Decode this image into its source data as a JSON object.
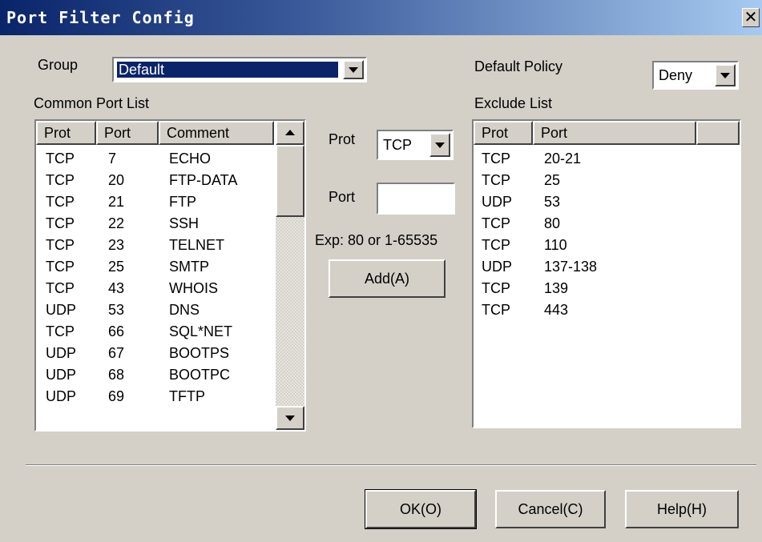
{
  "window": {
    "title": "Port Filter Config",
    "close_glyph": "✕"
  },
  "group": {
    "label": "Group",
    "selected": "Default"
  },
  "default_policy": {
    "label": "Default Policy",
    "selected": "Deny"
  },
  "common_list": {
    "label": "Common Port List",
    "columns": [
      "Prot",
      "Port",
      "Comment"
    ],
    "rows": [
      [
        "TCP",
        "7",
        "ECHO"
      ],
      [
        "TCP",
        "20",
        "FTP-DATA"
      ],
      [
        "TCP",
        "21",
        "FTP"
      ],
      [
        "TCP",
        "22",
        "SSH"
      ],
      [
        "TCP",
        "23",
        "TELNET"
      ],
      [
        "TCP",
        "25",
        "SMTP"
      ],
      [
        "TCP",
        "43",
        "WHOIS"
      ],
      [
        "UDP",
        "53",
        "DNS"
      ],
      [
        "TCP",
        "66",
        "SQL*NET"
      ],
      [
        "UDP",
        "67",
        "BOOTPS"
      ],
      [
        "UDP",
        "68",
        "BOOTPC"
      ],
      [
        "UDP",
        "69",
        "TFTP"
      ]
    ]
  },
  "editor": {
    "prot_label": "Prot",
    "prot_selected": "TCP",
    "port_label": "Port",
    "port_value": "",
    "hint": "Exp: 80 or 1-65535",
    "add_button": "Add(A)"
  },
  "exclude_list": {
    "label": "Exclude List",
    "columns": [
      "Prot",
      "Port"
    ],
    "rows": [
      [
        "TCP",
        "20-21"
      ],
      [
        "TCP",
        "25"
      ],
      [
        "UDP",
        "53"
      ],
      [
        "TCP",
        "80"
      ],
      [
        "TCP",
        "110"
      ],
      [
        "UDP",
        "137-138"
      ],
      [
        "TCP",
        "139"
      ],
      [
        "TCP",
        "443"
      ]
    ]
  },
  "footer": {
    "ok_button": "OK(O)",
    "cancel_button": "Cancel(C)",
    "help_button": "Help(H)"
  },
  "colors": {
    "title_gradient_start": "#0a246a",
    "title_gradient_end": "#a6caf0",
    "selection": "#0a246a",
    "face": "#d4d0c8"
  }
}
